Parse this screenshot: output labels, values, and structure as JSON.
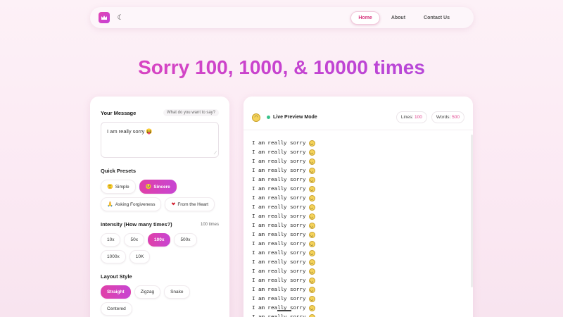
{
  "nav": {
    "links": [
      {
        "label": "Home",
        "active": true
      },
      {
        "label": "About",
        "active": false
      },
      {
        "label": "Contact Us",
        "active": false
      }
    ]
  },
  "hero": {
    "title": "Sorry 100, 1000, & 10000 times"
  },
  "message": {
    "label": "Your Message",
    "hint": "What do you want to say?",
    "value": "I am really sorry 😝"
  },
  "presets": {
    "label": "Quick Presets",
    "items": [
      {
        "label": "Simple",
        "icon": "🙂"
      },
      {
        "label": "Sincere",
        "icon": "🥺"
      },
      {
        "label": "Asking Forgiveness",
        "icon": "🙏"
      },
      {
        "label": "From the Heart",
        "icon": "❤"
      }
    ],
    "active_index": 1
  },
  "intensity": {
    "label": "Intensity (How many times?)",
    "current": "100 times",
    "options": [
      "10x",
      "50x",
      "100x",
      "500x",
      "1000x",
      "10K"
    ],
    "active_index": 2
  },
  "layout": {
    "label": "Layout Style",
    "options": [
      "Straight",
      "Zigzag",
      "Snake",
      "Centered"
    ],
    "active_index": 0
  },
  "preview": {
    "title": "Live Preview Mode",
    "lines_label": "Lines:",
    "lines_value": "100",
    "words_label": "Words:",
    "words_value": "500",
    "line_text": "I am really sorry",
    "visible_lines": 20
  },
  "colors": {
    "accent": "#e040a8",
    "accent_alt": "#c845d2",
    "status_dot": "#37c28a"
  }
}
